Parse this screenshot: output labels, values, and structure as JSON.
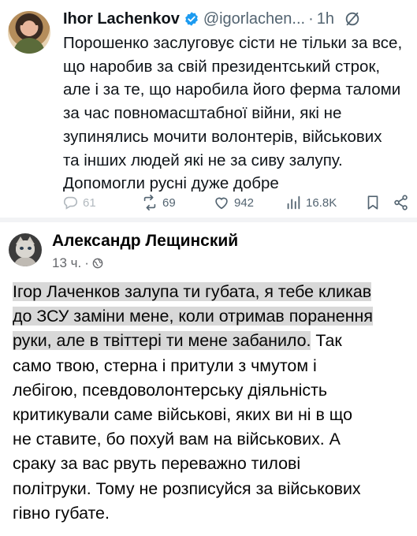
{
  "tweet": {
    "author_name": "Ihor Lachenkov",
    "handle": "@igorlachen...",
    "separator": "·",
    "time": "1h",
    "text_lines": [
      "Порошенко заслуговує сісти не тільки за все,",
      "що наробив за свій президентський строк,",
      "але і за те, що наробила його ферма таломи",
      "за час повномасштабної війни, які не",
      "зупинялись мочити волонтерів, військових",
      "та інших людей які не за сиву залупу.",
      "Допомогли русні дуже добре"
    ],
    "actions": {
      "replies": "61",
      "retweets": "69",
      "likes": "942",
      "views": "16.8K"
    },
    "icons": [
      "verified-badge-icon",
      "grok-icon",
      "reply-icon",
      "retweet-icon",
      "like-icon",
      "views-icon",
      "bookmark-icon",
      "share-icon"
    ],
    "colors": {
      "verified": "#1d9bf0",
      "secondary": "#536471"
    }
  },
  "post": {
    "author_name": "Александр Лещинский",
    "time": "13 ч.",
    "separator": "·",
    "highlighted_lines": [
      "Ігор Лаченков  залупа ти губата, я тебе кликав",
      "до ЗСУ заміни мене, коли отримав поранення",
      "руки, але в твіттері ти мене забанило."
    ],
    "line3_tail": " Так",
    "plain_lines": [
      "само твою, стерна і притули з чмутом і",
      "лебігою, псевдоволонтерську діяльність",
      "критикували саме військові, яких ви ні в що",
      "не ставите, бо похуй вам на військових. А",
      "сраку за вас рвуть переважно тилові",
      "політруки. Тому не розписуйся за військових",
      "гівно губате."
    ],
    "icons": [
      "globe-icon"
    ],
    "colors": {
      "highlight": "#d8d8d8",
      "meta": "#65676b"
    }
  }
}
